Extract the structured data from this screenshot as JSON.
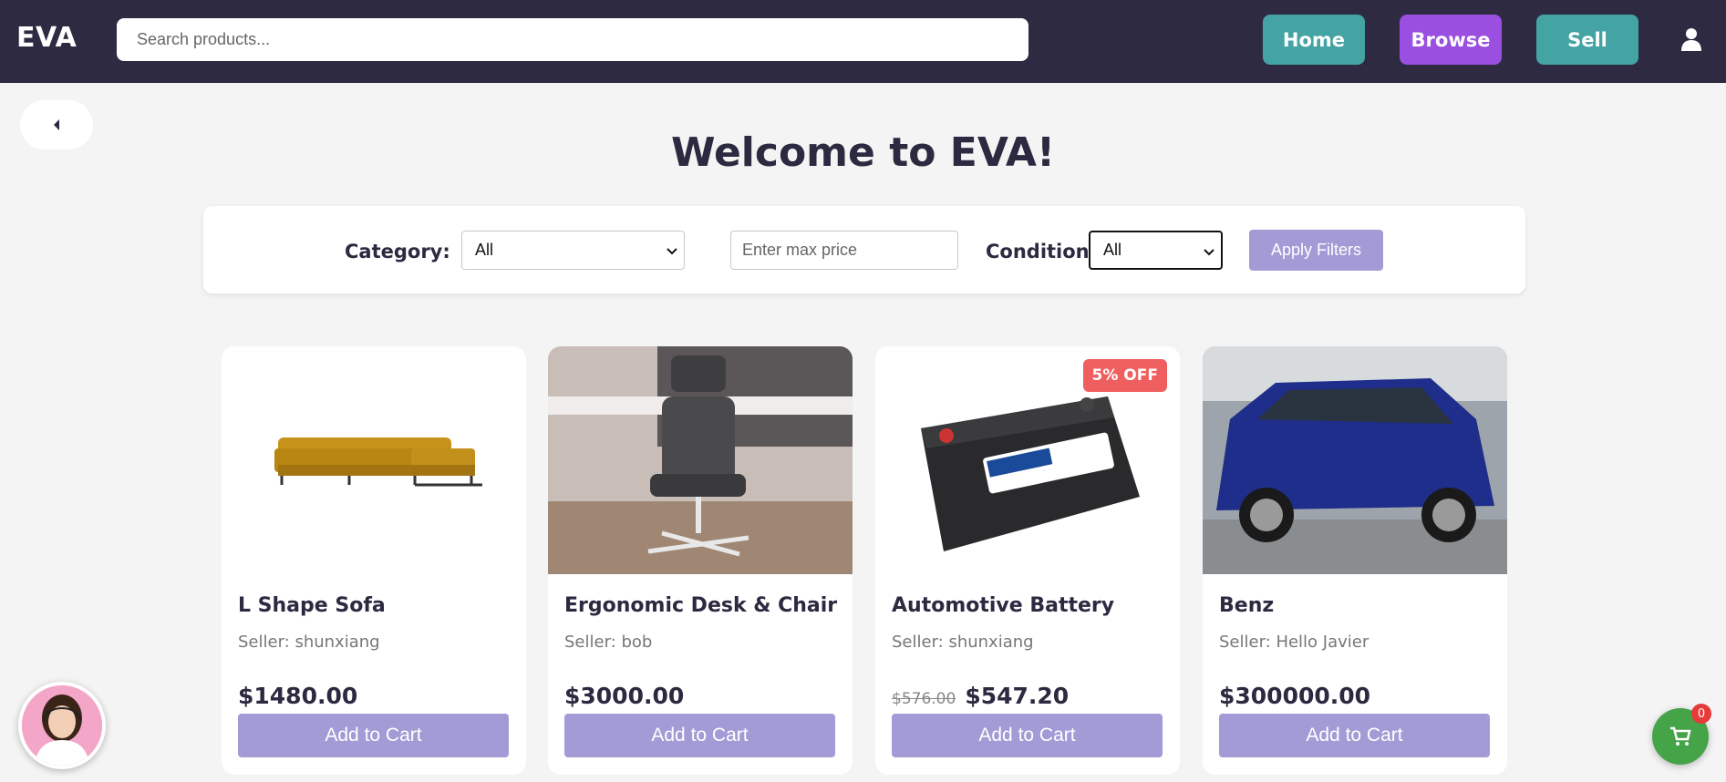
{
  "header": {
    "logo": "EVA",
    "search_placeholder": "Search products...",
    "nav": {
      "home": "Home",
      "browse": "Browse",
      "sell": "Sell"
    }
  },
  "main": {
    "welcome": "Welcome to EVA!"
  },
  "filters": {
    "category_label": "Category:",
    "category_value": "All",
    "max_price_placeholder": "Enter max price",
    "condition_label": "Condition:",
    "condition_value": "All",
    "apply_label": "Apply Filters"
  },
  "products": [
    {
      "title": "L Shape Sofa",
      "seller": "Seller: shunxiang",
      "price": "$1480.00",
      "add_label": "Add to Cart"
    },
    {
      "title": "Ergonomic Desk & Chair",
      "seller": "Seller: bob",
      "price": "$3000.00",
      "add_label": "Add to Cart"
    },
    {
      "title": "Automotive Battery",
      "seller": "Seller: shunxiang",
      "old_price": "$576.00",
      "price": "$547.20",
      "badge": "5% OFF",
      "add_label": "Add to Cart"
    },
    {
      "title": "Benz",
      "seller": "Seller: Hello Javier",
      "price": "$300000.00",
      "add_label": "Add to Cart"
    }
  ],
  "cart": {
    "count": "0"
  },
  "colors": {
    "header_bg": "#2d2a41",
    "teal": "#44a3a3",
    "purple": "#9a4fe0",
    "button_lavender": "#a29bd5",
    "badge_red": "#ef5f5f",
    "cart_green": "#45a348"
  },
  "icons": [
    "user-icon",
    "back-arrow-icon",
    "chevron-down-icon",
    "cart-icon",
    "support-avatar"
  ]
}
